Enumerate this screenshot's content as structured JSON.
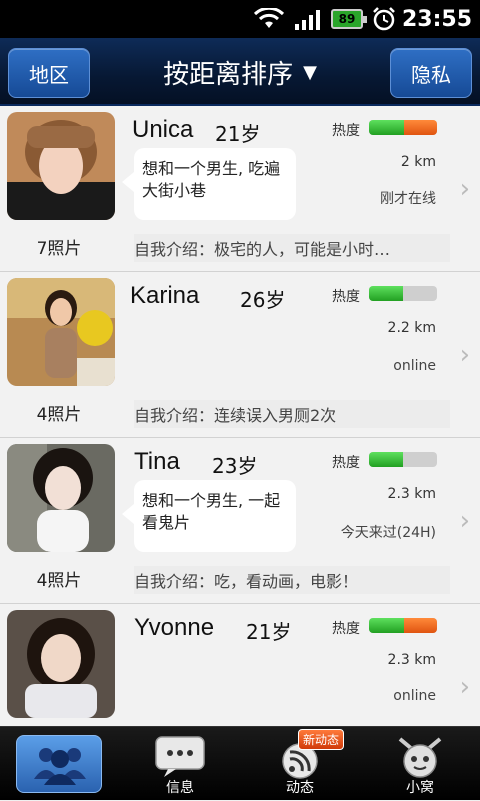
{
  "status_bar": {
    "battery": "89",
    "time": "23:55"
  },
  "nav": {
    "left_button": "地区",
    "title": "按距离排序",
    "right_button": "隐私"
  },
  "heat_label": "热度",
  "users": [
    {
      "name": "Unica",
      "age": "21岁",
      "bubble": "想和一个男生, 吃遍大街小巷",
      "heat_green": 0.52,
      "heat_orange": 0.48,
      "distance": "2 km",
      "status": "刚才在线",
      "photos": "7照片",
      "intro": "自我介绍：极宅的人，可能是小时…"
    },
    {
      "name": "Karina",
      "age": "26岁",
      "bubble": "",
      "heat_green": 0.5,
      "heat_orange": 0.0,
      "distance": "2.2 km",
      "status": "online",
      "photos": "4照片",
      "intro": "自我介绍：连续误入男厕2次"
    },
    {
      "name": "Tina",
      "age": "23岁",
      "bubble": "想和一个男生, 一起看鬼片",
      "heat_green": 0.5,
      "heat_orange": 0.0,
      "distance": "2.3 km",
      "status": "今天来过(24H)",
      "photos": "4照片",
      "intro": "自我介绍：吃，看动画，电影！"
    },
    {
      "name": "Yvonne",
      "age": "21岁",
      "bubble": "",
      "heat_green": 0.52,
      "heat_orange": 0.48,
      "distance": "2.3 km",
      "status": "online",
      "photos": "",
      "intro": ""
    }
  ],
  "tabs": [
    {
      "label": "",
      "icon": "people-icon",
      "active": true
    },
    {
      "label": "信息",
      "icon": "message-icon"
    },
    {
      "label": "动态",
      "icon": "feed-icon",
      "badge": "新动态"
    },
    {
      "label": "小窝",
      "icon": "home-mascot-icon"
    }
  ],
  "colors": {
    "heat_green": "#22a022",
    "heat_orange": "#e05410",
    "nav_bg": "#071833",
    "nav_button": "#1f5aaa"
  }
}
